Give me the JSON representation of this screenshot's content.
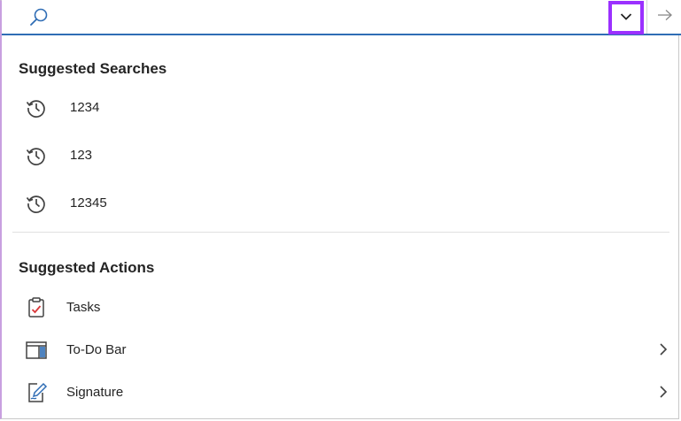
{
  "search": {
    "value": "",
    "placeholder": ""
  },
  "icons": {
    "search": "search-icon",
    "dropdown": "chevron-down-icon",
    "go": "arrow-right-icon",
    "history": "history-icon",
    "tasks": "tasks-clipboard-icon",
    "todo_bar": "todo-bar-icon",
    "signature": "signature-pen-icon",
    "submenu": "chevron-right-icon"
  },
  "colors": {
    "accent_underline": "#2f6db5",
    "highlight_box": "#9b30ff",
    "task_check": "#d9383a",
    "signature_pen": "#2f6db5"
  },
  "suggested_searches": {
    "title": "Suggested Searches",
    "items": [
      {
        "label": "1234"
      },
      {
        "label": "123"
      },
      {
        "label": "12345"
      }
    ]
  },
  "suggested_actions": {
    "title": "Suggested Actions",
    "items": [
      {
        "label": "Tasks",
        "has_submenu": false
      },
      {
        "label": "To-Do Bar",
        "has_submenu": true
      },
      {
        "label": "Signature",
        "has_submenu": true
      }
    ]
  }
}
